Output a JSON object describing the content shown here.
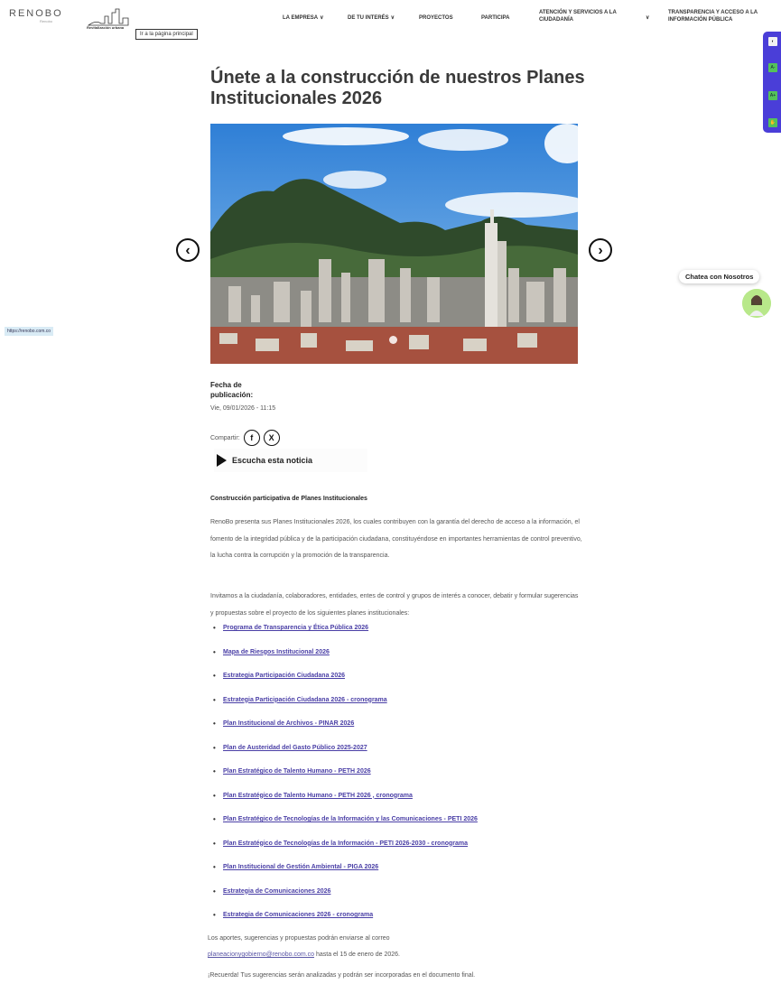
{
  "header": {
    "logo": "RENOBO",
    "logo_sub": "Renobo",
    "logo2_text": "Revitalización urbana",
    "skip_link": "Ir a la página principal",
    "nav": [
      {
        "label": "LA EMPRESA",
        "dropdown": true
      },
      {
        "label": "DE TU INTERÉS",
        "dropdown": true
      },
      {
        "label": "PROYECTOS",
        "dropdown": false
      },
      {
        "label": "PARTICIPA",
        "dropdown": false
      },
      {
        "label": "ATENCIÓN Y SERVICIOS A LA CIUDADANÍA",
        "dropdown": true
      },
      {
        "label": "TRANSPARENCIA Y ACCESO A LA INFORMACIÓN PÚBLICA",
        "dropdown": false
      }
    ]
  },
  "a11y": {
    "contrast": "◐",
    "decrease": "A-",
    "increase": "A+",
    "sign": "✋"
  },
  "article": {
    "title": "Únete a la construcción de nuestros Planes Institucionales 2026",
    "meta_label": "Fecha de publicación:",
    "date": "Vie, 09/01/2026 - 11:15",
    "share_label": "Compartir:",
    "listen_label": "Escucha esta noticia",
    "section_title": "Construcción participativa de Planes Institucionales",
    "para1": "RenoBo presenta sus Planes Institucionales 2026, los cuales contribuyen con la garantía del derecho de acceso a la información, el fomento de la integridad pública y de la participación ciudadana, constituyéndose en importantes herramientas de control preventivo, la lucha contra la corrupción y la promoción de la transparencia.",
    "para2": "Invitamos a la ciudadanía, colaboradores, entidades, entes de control y grupos de interés a conocer, debatir y formular sugerencias y propuestas sobre el proyecto de los siguientes planes institucionales:",
    "links": [
      "Programa de Transparencia y Ética Pública 2026",
      "Mapa de Riesgos Institucional 2026",
      "Estrategia Participación Ciudadana 2026",
      "Estrategia Participación Ciudadana 2026 - cronograma",
      "Plan Institucional de Archivos - PINAR 2026",
      "Plan de Austeridad del Gasto Público 2025-2027",
      "Plan Estratégico de Talento Humano - PETH 2026",
      "Plan Estratégico de Talento Humano - PETH 2026 , cronograma",
      "Plan Estratégico de Tecnologías de la Información y las Comunicaciones - PETI 2026",
      "Plan Estratégico de Tecnologías de la Información -  PETI 2026-2030 - cronograma",
      "Plan Institucional de Gestión Ambiental - PIGA 2026",
      "Estrategia de Comunicaciones 2026",
      "Estrategia de Comunicaciones 2026 - cronograma"
    ],
    "footer1": "Los aportes, sugerencias y propuestas podrán enviarse al correo",
    "email": "planeacionygobierno@renobo.com.co",
    "footer2_rest": " hasta el 15 de enero de 2026.",
    "footer3": "¡Recuerda! Tus sugerencias serán analizadas y podrán ser incorporadas en el documento final."
  },
  "url_tooltip": "https://renobo.com.co",
  "chat_label": "Chatea con Nosotros"
}
